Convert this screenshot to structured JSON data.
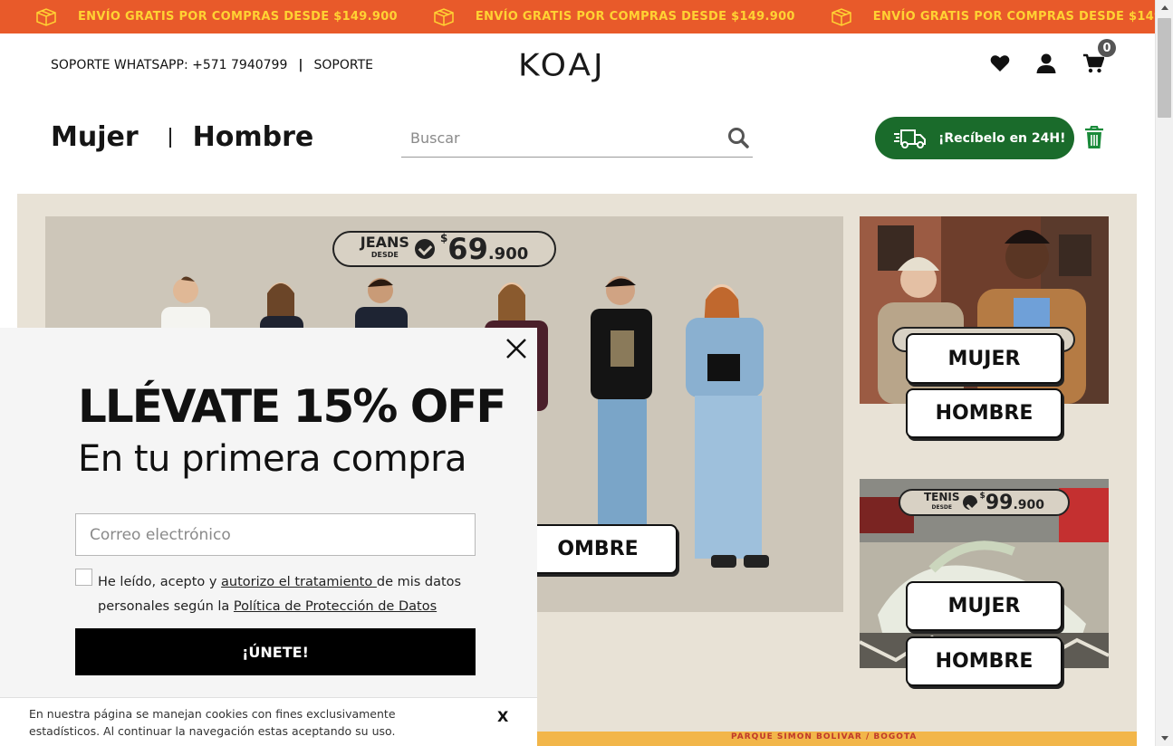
{
  "promo": {
    "text": "ENVÍO GRATIS POR COMPRAS DESDE $149.900",
    "colors": {
      "background": "#e85a2a",
      "text": "#ffd233"
    }
  },
  "header": {
    "support_whatsapp": "SOPORTE WHATSAPP: +571 7940799",
    "separator": "|",
    "support_link": "SOPORTE",
    "logo": "KOAJ",
    "cart_count": "0"
  },
  "nav": {
    "mujer": "Mujer",
    "hombre": "Hombre"
  },
  "search": {
    "placeholder": "Buscar"
  },
  "express": {
    "label": "¡Recíbelo en 24H!",
    "color": "#1a6b2b"
  },
  "hero": {
    "main_promo": {
      "category": "JEANS",
      "desde": "DESDE",
      "currency": "$",
      "price": "69",
      "cents": ".900"
    },
    "main_cta_partial": "OMBRE",
    "right1": {
      "cta_mujer": "MUJER",
      "cta_hombre": "HOMBRE"
    },
    "right2": {
      "promo": {
        "category": "TENIS",
        "desde": "DESDE",
        "currency": "$",
        "price": "99",
        "cents": ".900"
      },
      "cta_mujer": "MUJER",
      "cta_hombre": "HOMBRE"
    },
    "bottom_strip_text": "PARQUE SIMON BOLIVAR / BOGOTA"
  },
  "modal": {
    "title": "LLÉVATE 15% OFF",
    "subtitle": "En tu primera compra",
    "email_placeholder": "Correo electrónico",
    "consent_pre": "He leído, acepto y ",
    "consent_link1": "autorizo el tratamiento ",
    "consent_mid": "de mis datos personales según la ",
    "consent_link2": "Política de Protección de Datos",
    "join_label": "¡ÚNETE!"
  },
  "cookie": {
    "text": "En nuestra página se manejan cookies con fines exclusivamente estadísticos. Al continuar la navegación estas aceptando su uso.",
    "close": "X"
  },
  "icons": [
    "box-icon",
    "heart-icon",
    "user-icon",
    "cart-icon",
    "search-icon",
    "truck-icon",
    "trash-icon",
    "close-icon",
    "checkmark-icon"
  ]
}
